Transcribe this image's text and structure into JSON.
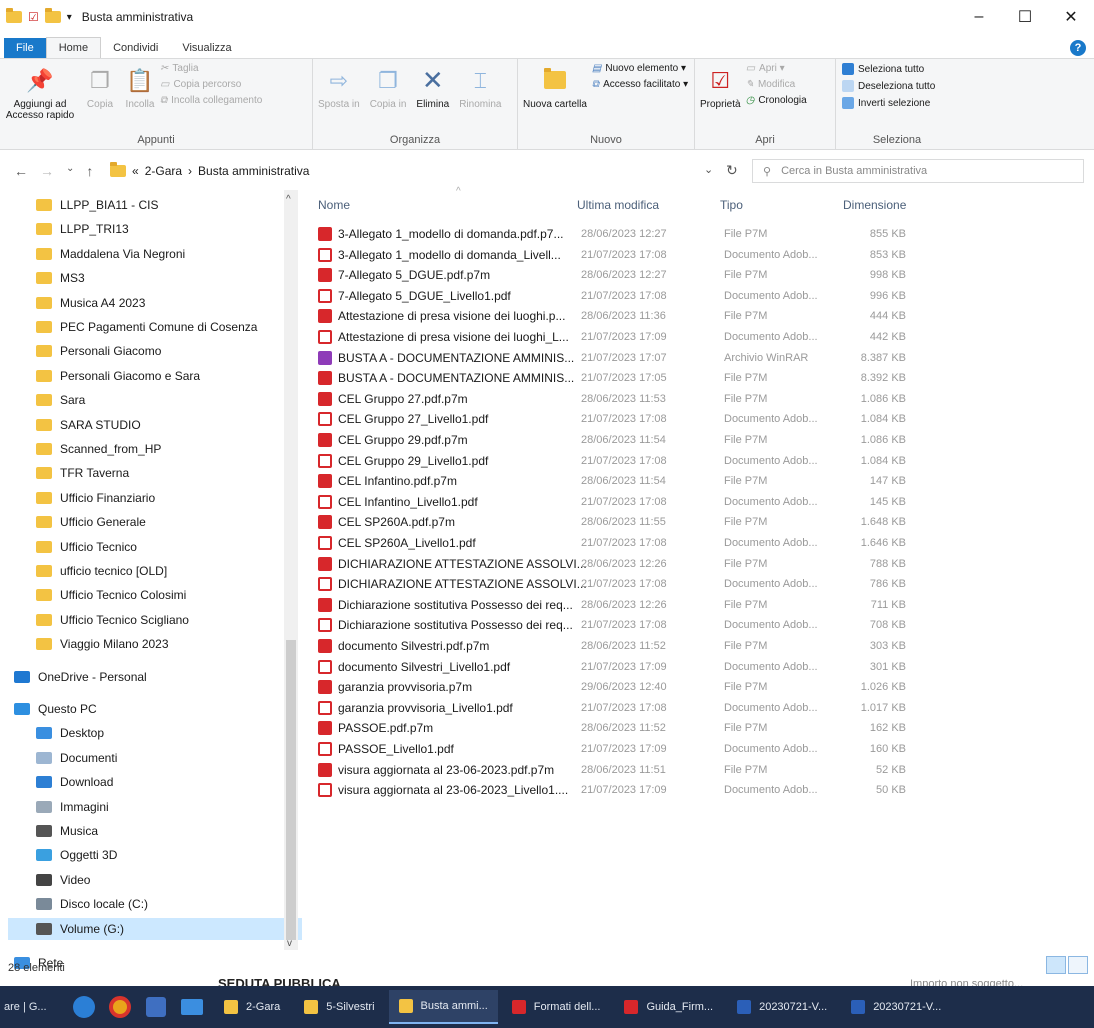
{
  "window": {
    "title": "Busta amministrativa",
    "min": "–",
    "max": "☐",
    "close": "✕"
  },
  "menu_tabs": [
    "File",
    "Home",
    "Condividi",
    "Visualizza"
  ],
  "help": "?",
  "ribbon": {
    "appunti": {
      "label": "Appunti",
      "pin": "Aggiungi ad Accesso rapido",
      "copia": "Copia",
      "incolla": "Incolla",
      "taglia": "Taglia",
      "copia_percorso": "Copia percorso",
      "incolla_collegamento": "Incolla collegamento"
    },
    "organizza": {
      "label": "Organizza",
      "sposta": "Sposta in",
      "copia": "Copia in",
      "elimina": "Elimina",
      "rinomina": "Rinomina"
    },
    "nuovo": {
      "label": "Nuovo",
      "nuova_cartella": "Nuova cartella",
      "nuovo_elemento": "Nuovo elemento ▾",
      "accesso_facilitato": "Accesso facilitato ▾"
    },
    "apri": {
      "label": "Apri",
      "proprieta": "Proprietà",
      "apri": "Apri ▾",
      "modifica": "Modifica",
      "cronologia": "Cronologia"
    },
    "seleziona": {
      "label": "Seleziona",
      "tutto": "Seleziona tutto",
      "deseleziona": "Deseleziona tutto",
      "inverti": "Inverti selezione"
    }
  },
  "address": {
    "prefix": "«",
    "crumb1": "2-Gara",
    "sep": "›",
    "crumb2": "Busta amministrativa",
    "search_placeholder": "Cerca in Busta amministrativa"
  },
  "nav_items": [
    "LLPP_BIA11 - CIS",
    "LLPP_TRI13",
    "Maddalena Via Negroni",
    "MS3",
    "Musica A4 2023",
    "PEC Pagamenti Comune di Cosenza",
    "Personali Giacomo",
    "Personali Giacomo e Sara",
    "Sara",
    "SARA STUDIO",
    "Scanned_from_HP",
    "TFR Taverna",
    "Ufficio Finanziario",
    "Ufficio Generale",
    "Ufficio Tecnico",
    "ufficio tecnico [OLD]",
    "Ufficio Tecnico Colosimi",
    "Ufficio Tecnico Scigliano",
    "Viaggio Milano 2023",
    "OneDrive - Personal",
    "Questo PC",
    "Desktop",
    "Documenti",
    "Download",
    "Immagini",
    "Musica",
    "Oggetti 3D",
    "Video",
    "Disco locale (C:)",
    "Volume (G:)",
    "Rete"
  ],
  "columns": {
    "name": "Nome",
    "modified": "Ultima modifica",
    "type": "Tipo",
    "size": "Dimensione"
  },
  "files": [
    [
      "3-Allegato 1_modello di domanda.pdf.p7...",
      "28/06/2023 12:27",
      "File P7M",
      "855 KB",
      "p7m"
    ],
    [
      "3-Allegato 1_modello di domanda_Livell...",
      "21/07/2023 17:08",
      "Documento Adob...",
      "853 KB",
      "pdf"
    ],
    [
      "7-Allegato 5_DGUE.pdf.p7m",
      "28/06/2023 12:27",
      "File P7M",
      "998 KB",
      "p7m"
    ],
    [
      "7-Allegato 5_DGUE_Livello1.pdf",
      "21/07/2023 17:08",
      "Documento Adob...",
      "996 KB",
      "pdf"
    ],
    [
      "Attestazione di presa visione dei luoghi.p...",
      "28/06/2023 11:36",
      "File P7M",
      "444 KB",
      "p7m"
    ],
    [
      "Attestazione di presa visione dei luoghi_L...",
      "21/07/2023 17:09",
      "Documento Adob...",
      "442 KB",
      "pdf"
    ],
    [
      "BUSTA A - DOCUMENTAZIONE AMMINIS...",
      "21/07/2023 17:07",
      "Archivio WinRAR",
      "8.387 KB",
      "rar"
    ],
    [
      "BUSTA A - DOCUMENTAZIONE AMMINIS...",
      "21/07/2023 17:05",
      "File P7M",
      "8.392 KB",
      "p7m"
    ],
    [
      "CEL Gruppo 27.pdf.p7m",
      "28/06/2023 11:53",
      "File P7M",
      "1.086 KB",
      "p7m"
    ],
    [
      "CEL Gruppo 27_Livello1.pdf",
      "21/07/2023 17:08",
      "Documento Adob...",
      "1.084 KB",
      "pdf"
    ],
    [
      "CEL Gruppo 29.pdf.p7m",
      "28/06/2023 11:54",
      "File P7M",
      "1.086 KB",
      "p7m"
    ],
    [
      "CEL Gruppo 29_Livello1.pdf",
      "21/07/2023 17:08",
      "Documento Adob...",
      "1.084 KB",
      "pdf"
    ],
    [
      "CEL Infantino.pdf.p7m",
      "28/06/2023 11:54",
      "File P7M",
      "147 KB",
      "p7m"
    ],
    [
      "CEL Infantino_Livello1.pdf",
      "21/07/2023 17:08",
      "Documento Adob...",
      "145 KB",
      "pdf"
    ],
    [
      "CEL SP260A.pdf.p7m",
      "28/06/2023 11:55",
      "File P7M",
      "1.648 KB",
      "p7m"
    ],
    [
      "CEL SP260A_Livello1.pdf",
      "21/07/2023 17:08",
      "Documento Adob...",
      "1.646 KB",
      "pdf"
    ],
    [
      "DICHIARAZIONE ATTESTAZIONE ASSOLVI...",
      "28/06/2023 12:26",
      "File P7M",
      "788 KB",
      "p7m"
    ],
    [
      "DICHIARAZIONE ATTESTAZIONE ASSOLVI...",
      "21/07/2023 17:08",
      "Documento Adob...",
      "786 KB",
      "pdf"
    ],
    [
      "Dichiarazione sostitutiva Possesso dei req...",
      "28/06/2023 12:26",
      "File P7M",
      "711 KB",
      "p7m"
    ],
    [
      "Dichiarazione sostitutiva Possesso dei req...",
      "21/07/2023 17:08",
      "Documento Adob...",
      "708 KB",
      "pdf"
    ],
    [
      "documento Silvestri.pdf.p7m",
      "28/06/2023 11:52",
      "File P7M",
      "303 KB",
      "p7m"
    ],
    [
      "documento Silvestri_Livello1.pdf",
      "21/07/2023 17:09",
      "Documento Adob...",
      "301 KB",
      "pdf"
    ],
    [
      "garanzia provvisoria.p7m",
      "29/06/2023 12:40",
      "File P7M",
      "1.026 KB",
      "p7m"
    ],
    [
      "garanzia provvisoria_Livello1.pdf",
      "21/07/2023 17:08",
      "Documento Adob...",
      "1.017 KB",
      "pdf"
    ],
    [
      "PASSOE.pdf.p7m",
      "28/06/2023 11:52",
      "File P7M",
      "162 KB",
      "p7m"
    ],
    [
      "PASSOE_Livello1.pdf",
      "21/07/2023 17:09",
      "Documento Adob...",
      "160 KB",
      "pdf"
    ],
    [
      "visura aggiornata al 23-06-2023.pdf.p7m",
      "28/06/2023 11:51",
      "File P7M",
      "52 KB",
      "p7m"
    ],
    [
      "visura aggiornata al 23-06-2023_Livello1....",
      "21/07/2023 17:09",
      "Documento Adob...",
      "50 KB",
      "pdf"
    ]
  ],
  "status": "28 elementi",
  "background_text": {
    "seduta": "SEDUTA PUBBLICA",
    "importo": "Importo non soggetto..."
  },
  "taskbar": {
    "start_text": "are | G...",
    "tasks": [
      "2-Gara",
      "5-Silvestri",
      "Busta ammi...",
      "Formati dell...",
      "Guida_Firm...",
      "20230721-V...",
      "20230721-V..."
    ]
  }
}
